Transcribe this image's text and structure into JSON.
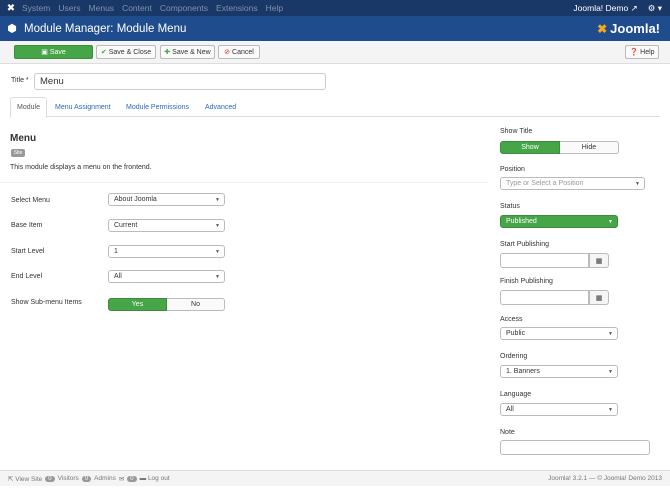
{
  "topnav": {
    "logo_icon": "joomla-icon",
    "menu": [
      "System",
      "Users",
      "Menus",
      "Content",
      "Components",
      "Extensions",
      "Help"
    ],
    "site_link": "Joomla! Demo",
    "external_icon": "external-link-icon",
    "gear_icon": "gear-icon",
    "caret": "▾"
  },
  "header": {
    "icon": "cube-icon",
    "title": "Module Manager: Module Menu",
    "brand": "Joomla!"
  },
  "toolbar": {
    "save": "Save",
    "save_close": "Save & Close",
    "save_new": "Save & New",
    "cancel": "Cancel",
    "help": "Help"
  },
  "form": {
    "title_label": "Title *",
    "title_value": "Menu"
  },
  "tabs": [
    "Module",
    "Menu Assignment",
    "Module Permissions",
    "Advanced"
  ],
  "module": {
    "heading": "Menu",
    "badge": "Site",
    "description": "This module displays a menu on the frontend."
  },
  "fields": {
    "select_menu": {
      "label": "Select Menu",
      "value": "About Joomla"
    },
    "base_item": {
      "label": "Base Item",
      "value": "Current"
    },
    "start_level": {
      "label": "Start Level",
      "value": "1"
    },
    "end_level": {
      "label": "End Level",
      "value": "All"
    },
    "show_submenu": {
      "label": "Show Sub-menu Items",
      "yes": "Yes",
      "no": "No"
    }
  },
  "side": {
    "show_title": {
      "label": "Show Title",
      "show": "Show",
      "hide": "Hide"
    },
    "position": {
      "label": "Position",
      "placeholder": "Type or Select a Position"
    },
    "status": {
      "label": "Status",
      "value": "Published"
    },
    "start_publishing": {
      "label": "Start Publishing"
    },
    "finish_publishing": {
      "label": "Finish Publishing"
    },
    "access": {
      "label": "Access",
      "value": "Public"
    },
    "ordering": {
      "label": "Ordering",
      "value": "1. Banners"
    },
    "language": {
      "label": "Language",
      "value": "All"
    },
    "note": {
      "label": "Note"
    }
  },
  "footer": {
    "view_site": "View Site",
    "visitors_count": "0",
    "visitors": "Visitors",
    "admins_count": "0",
    "admins": "Admins",
    "messages_count": "0",
    "logout": "Log out",
    "copyright": "Joomla! 3.2.1 — © Joomla! Demo 2013"
  },
  "colors": {
    "top_nav": "#1a3867",
    "header": "#1f4c8c",
    "green": "#46a546",
    "link": "#2a69b8"
  }
}
